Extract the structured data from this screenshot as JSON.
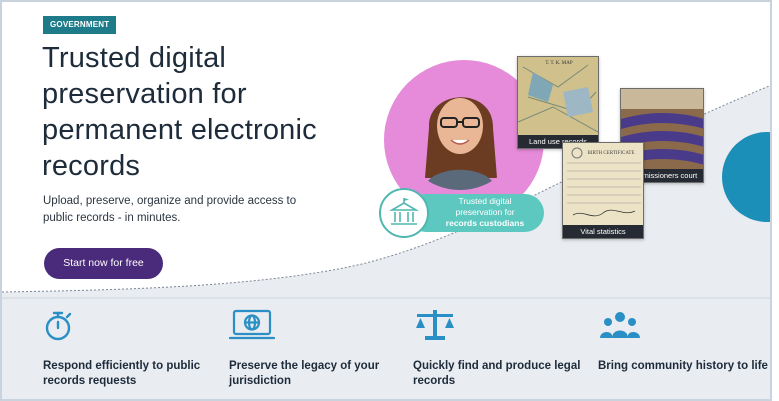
{
  "badge": "GOVERNMENT",
  "headline": "Trusted digital preservation for permanent electronic records",
  "subtitle": "Upload, preserve, organize and provide access to public records - in minutes.",
  "cta_label": "Start now for free",
  "pill": {
    "line1": "Trusted digital",
    "line2": "preservation for",
    "line3": "records custodians"
  },
  "cards": [
    {
      "caption": "Land use records"
    },
    {
      "caption": "Commissioners court"
    },
    {
      "caption": "Vital statistics"
    }
  ],
  "features": [
    {
      "icon": "stopwatch-icon",
      "title": "Respond efficiently to public records requests"
    },
    {
      "icon": "laptop-globe-icon",
      "title": "Preserve the legacy of your jurisdiction"
    },
    {
      "icon": "scales-icon",
      "title": "Quickly find and produce legal records"
    },
    {
      "icon": "community-icon",
      "title": "Bring community history to life"
    }
  ],
  "colors": {
    "accent_teal": "#1d7b8a",
    "cta_purple": "#4a2a7a",
    "icon_blue": "#2a8fc4",
    "pink": "#e58bd9",
    "grey_band": "#e9ecf1"
  }
}
